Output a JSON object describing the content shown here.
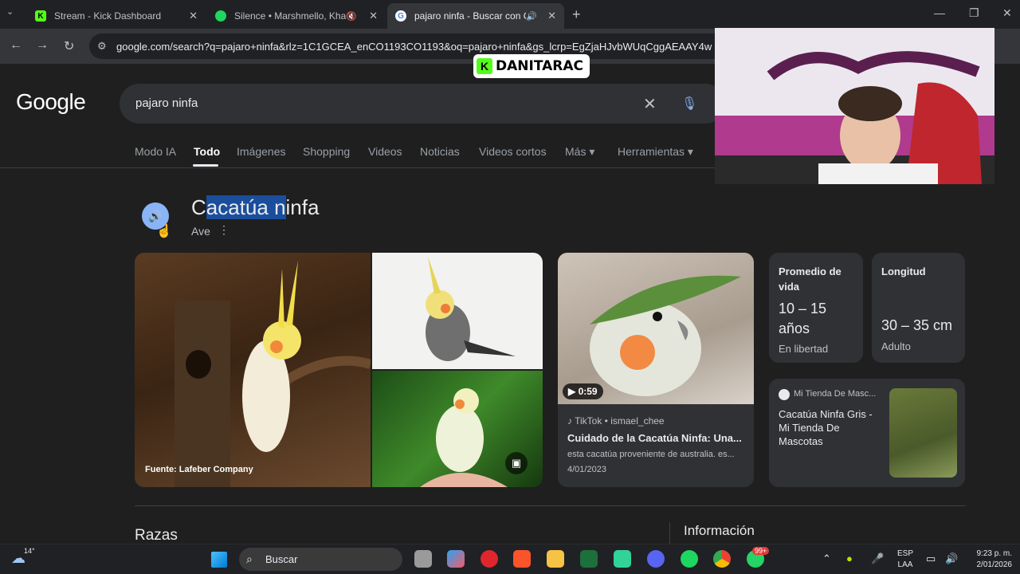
{
  "browser": {
    "tabs": [
      {
        "title": "Stream - Kick Dashboard",
        "favicon": "kick-icon",
        "fav_color": "#53fc18"
      },
      {
        "title": "Silence • Marshmello, Khalid",
        "favicon": "spotify-icon",
        "fav_color": "#1ed760"
      },
      {
        "title": "pajaro ninfa - Buscar con Google",
        "favicon": "google-icon",
        "fav_color": "#ffffff"
      }
    ],
    "url": "google.com/search?q=pajaro+ninfa&rlz=1C1GCEA_enCO1193CO1193&oq=pajaro+ninfa&gs_lcrp=EgZjaHJvbWUqCggAEAAY4w"
  },
  "google": {
    "logo": "Google",
    "query": "pajaro ninfa",
    "nav": [
      "Modo IA",
      "Todo",
      "Imágenes",
      "Shopping",
      "Videos",
      "Noticias",
      "Videos cortos",
      "Más ▾",
      "Herramientas ▾"
    ],
    "active_nav": "Todo"
  },
  "entity": {
    "title_parts": [
      "C",
      "acatúa n",
      "infa"
    ],
    "subtitle": "Ave",
    "image_source": "Fuente: Lafeber Company"
  },
  "video": {
    "duration": "▶ 0:59",
    "source": "TikTok • ismael_chee",
    "title": "Cuidado de la Cacatúa Ninfa: Una...",
    "desc": "esta cacatúa proveniente de australia. es...",
    "date": "4/01/2023"
  },
  "facts": {
    "lifespan_label": "Promedio de vida",
    "lifespan_value_1": "10 – 15",
    "lifespan_value_2": "años",
    "lifespan_note": "En libertad",
    "length_label": "Longitud",
    "length_value": "30 – 35 cm",
    "length_note": "Adulto"
  },
  "shop": {
    "store": "Mi Tienda De Masc...",
    "title": "Cacatúa Ninfa Gris - Mi Tienda De Mascotas"
  },
  "sections": {
    "left": "Razas",
    "right": "Información"
  },
  "stream": {
    "badge_k": "K",
    "badge_name": "DANITARAC"
  },
  "taskbar": {
    "weather_temp": "14°",
    "search": "Buscar",
    "lang_1": "ESP",
    "lang_2": "LAA",
    "time": "9:23 p. m.",
    "date": "2/01/2026",
    "notif_badge": "99+"
  }
}
